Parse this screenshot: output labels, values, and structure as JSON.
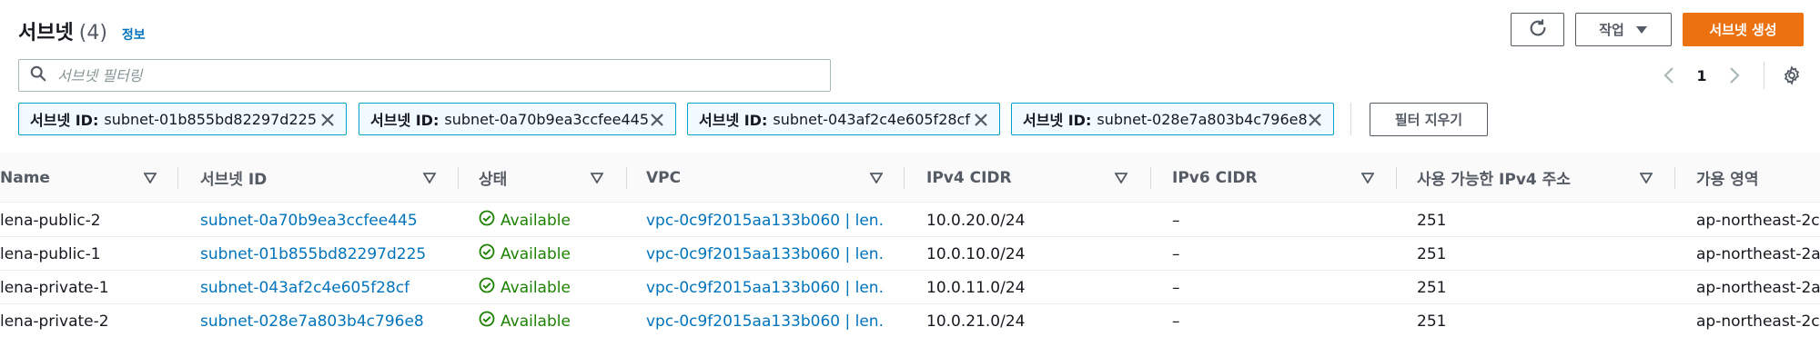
{
  "header": {
    "title": "서브넷",
    "count": "(4)",
    "info_link": "정보"
  },
  "toolbar": {
    "refresh_icon": "refresh-icon",
    "actions_label": "작업",
    "create_label": "서브넷 생성"
  },
  "search": {
    "placeholder": "서브넷 필터링",
    "value": ""
  },
  "pagination": {
    "current_page": "1"
  },
  "filters": {
    "tokens": [
      {
        "key": "서브넷 ID:",
        "value": "subnet-01b855bd82297d225"
      },
      {
        "key": "서브넷 ID:",
        "value": "subnet-0a70b9ea3ccfee445"
      },
      {
        "key": "서브넷 ID:",
        "value": "subnet-043af2c4e605f28cf"
      },
      {
        "key": "서브넷 ID:",
        "value": "subnet-028e7a803b4c796e8"
      }
    ],
    "clear_label": "필터 지우기"
  },
  "table": {
    "columns": [
      "Name",
      "서브넷 ID",
      "상태",
      "VPC",
      "IPv4 CIDR",
      "IPv6 CIDR",
      "사용 가능한 IPv4 주소",
      "가용 영역"
    ],
    "rows": [
      {
        "name": "lena-public-2",
        "subnet_id": "subnet-0a70b9ea3ccfee445",
        "status": "Available",
        "vpc": "vpc-0c9f2015aa133b060 | len...",
        "ipv4": "10.0.20.0/24",
        "ipv6": "–",
        "available_ipv4": "251",
        "az": "ap-northeast-2c"
      },
      {
        "name": "lena-public-1",
        "subnet_id": "subnet-01b855bd82297d225",
        "status": "Available",
        "vpc": "vpc-0c9f2015aa133b060 | len...",
        "ipv4": "10.0.10.0/24",
        "ipv6": "–",
        "available_ipv4": "251",
        "az": "ap-northeast-2a"
      },
      {
        "name": "lena-private-1",
        "subnet_id": "subnet-043af2c4e605f28cf",
        "status": "Available",
        "vpc": "vpc-0c9f2015aa133b060 | len...",
        "ipv4": "10.0.11.0/24",
        "ipv6": "–",
        "available_ipv4": "251",
        "az": "ap-northeast-2a"
      },
      {
        "name": "lena-private-2",
        "subnet_id": "subnet-028e7a803b4c796e8",
        "status": "Available",
        "vpc": "vpc-0c9f2015aa133b060 | len...",
        "ipv4": "10.0.21.0/24",
        "ipv6": "–",
        "available_ipv4": "251",
        "az": "ap-northeast-2c"
      }
    ]
  },
  "colors": {
    "primary": "#ec7211",
    "link": "#0073bb",
    "success": "#1d8102",
    "token_border": "#00a1c9"
  }
}
